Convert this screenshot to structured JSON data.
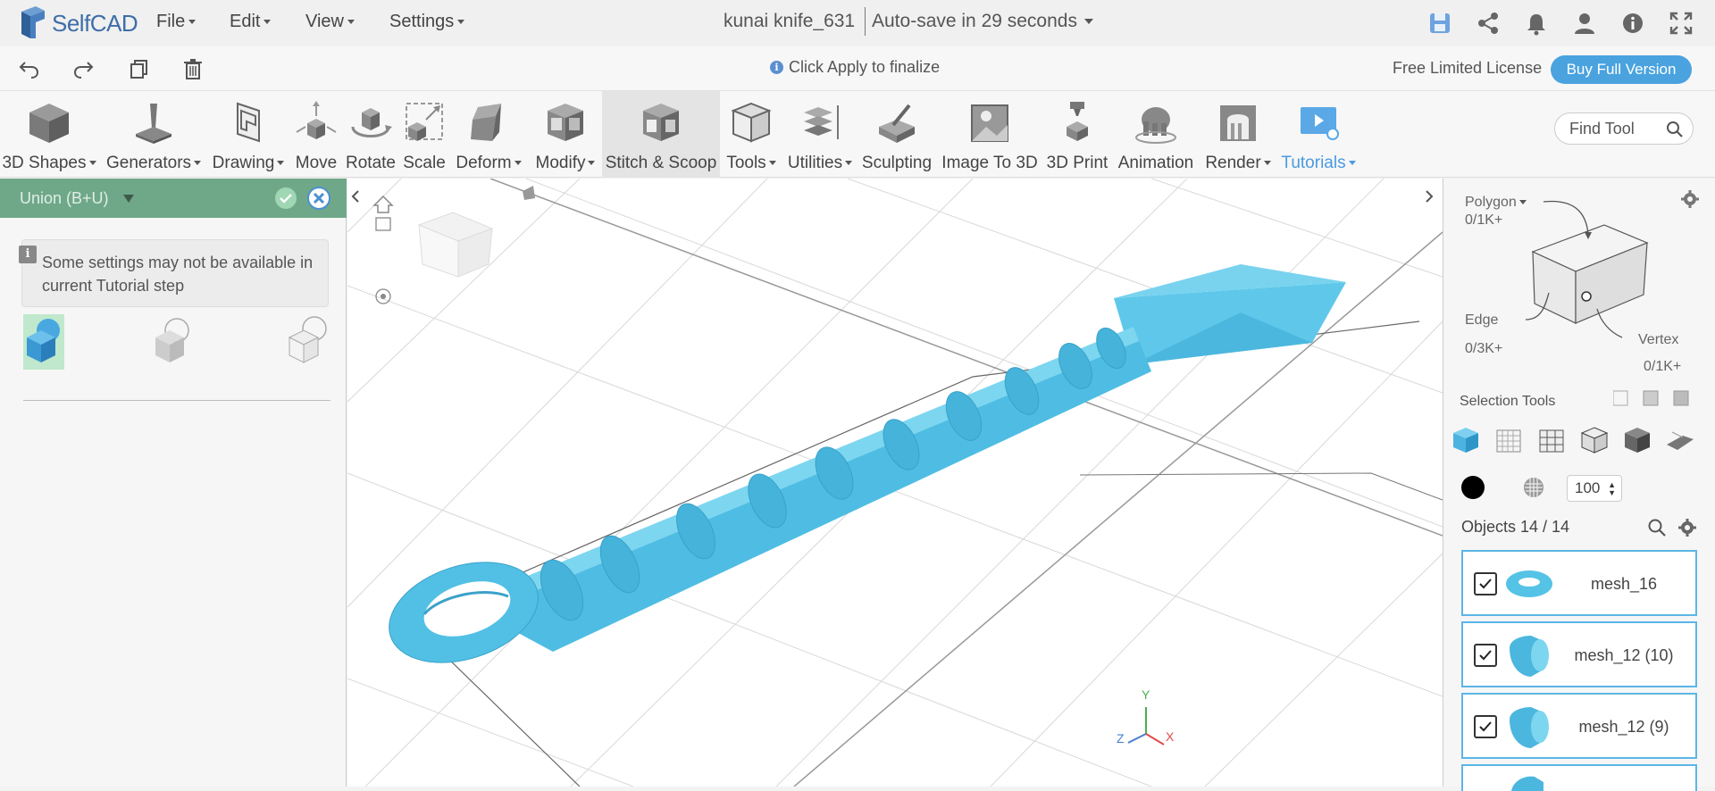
{
  "app": {
    "logo_text": "SelfCAD",
    "menus": [
      "File",
      "Edit",
      "View",
      "Settings"
    ],
    "document_title": "kunai knife_631",
    "autosave_text": "Auto-save in 29 seconds",
    "top_icons": [
      "save-icon",
      "share-icon",
      "bell-icon",
      "user-icon",
      "info-icon",
      "fullscreen-icon"
    ]
  },
  "bar2": {
    "icons": [
      "undo-icon",
      "redo-icon",
      "copy-icon",
      "trash-icon"
    ],
    "hint": "Click Apply to finalize",
    "license": "Free Limited License",
    "buy_label": "Buy Full Version"
  },
  "ribbon": {
    "tools": [
      {
        "label": "3D Shapes",
        "dropdown": true
      },
      {
        "label": "Generators",
        "dropdown": true
      },
      {
        "label": "Drawing",
        "dropdown": true
      },
      {
        "label": "Move",
        "dropdown": false
      },
      {
        "label": "Rotate",
        "dropdown": false
      },
      {
        "label": "Scale",
        "dropdown": false
      },
      {
        "label": "Deform",
        "dropdown": true
      },
      {
        "label": "Modify",
        "dropdown": true
      },
      {
        "label": "Stitch & Scoop",
        "dropdown": false,
        "active": true
      },
      {
        "label": "Tools",
        "dropdown": true
      },
      {
        "label": "Utilities",
        "dropdown": true
      },
      {
        "label": "Sculpting",
        "dropdown": false
      },
      {
        "label": "Image To 3D",
        "dropdown": false
      },
      {
        "label": "3D Print",
        "dropdown": false
      },
      {
        "label": "Animation",
        "dropdown": false
      },
      {
        "label": "Render",
        "dropdown": true
      },
      {
        "label": "Tutorials",
        "dropdown": true,
        "accent": "#4a9ae0"
      }
    ],
    "find_tool_placeholder": "Find Tool"
  },
  "left_panel": {
    "title": "Union (B+U)",
    "note": "Some settings may not be available in current Tutorial step",
    "header_color": "#6fa889"
  },
  "viewport": {
    "model_color": "#55c3e5",
    "axes": {
      "y": "Y",
      "z": "Z",
      "x": "X"
    }
  },
  "right_panel": {
    "polygon_label": "Polygon",
    "polygon_count": "0/1K+",
    "edge_label": "Edge",
    "edge_count": "0/3K+",
    "vertex_label": "Vertex",
    "vertex_count": "0/1K+",
    "selection_tools_label": "Selection Tools",
    "opacity_value": "100",
    "objects_label": "Objects 14 / 14",
    "objects": [
      {
        "name": "mesh_16",
        "checked": true,
        "thumb": "torus"
      },
      {
        "name": "mesh_12 (10)",
        "checked": true,
        "thumb": "cylinder"
      },
      {
        "name": "mesh_12 (9)",
        "checked": true,
        "thumb": "cylinder"
      }
    ]
  }
}
